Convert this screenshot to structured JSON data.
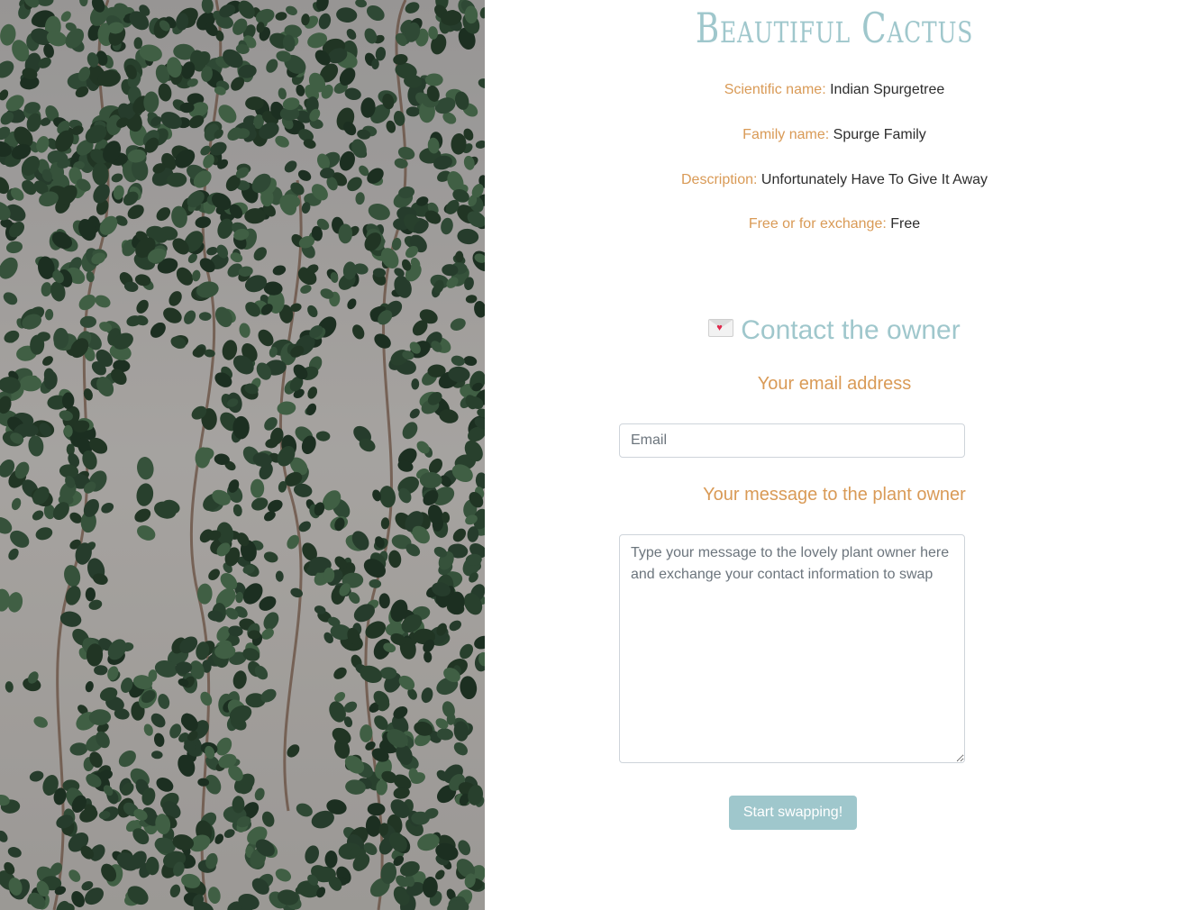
{
  "plant": {
    "title": "Beautiful Cactus",
    "scientific_label": "Scientific name:",
    "scientific_value": "Indian Spurgetree",
    "family_label": "Family name:",
    "family_value": "Spurge Family",
    "description_label": "Description:",
    "description_value": "Unfortunately Have To Give It Away",
    "exchange_label": "Free or for exchange:",
    "exchange_value": "Free"
  },
  "contact": {
    "heading": "Contact the owner",
    "email_label": "Your email address",
    "email_placeholder": "Email",
    "message_label": "Your message to the plant owner",
    "message_placeholder": "Type your message to the lovely plant owner here and exchange your contact information to swap",
    "submit_label": "Start swapping!"
  },
  "colors": {
    "accent_teal": "#9fc7cc",
    "accent_orange": "#d99a56"
  },
  "icons": {
    "contact": "love-letter-icon"
  }
}
